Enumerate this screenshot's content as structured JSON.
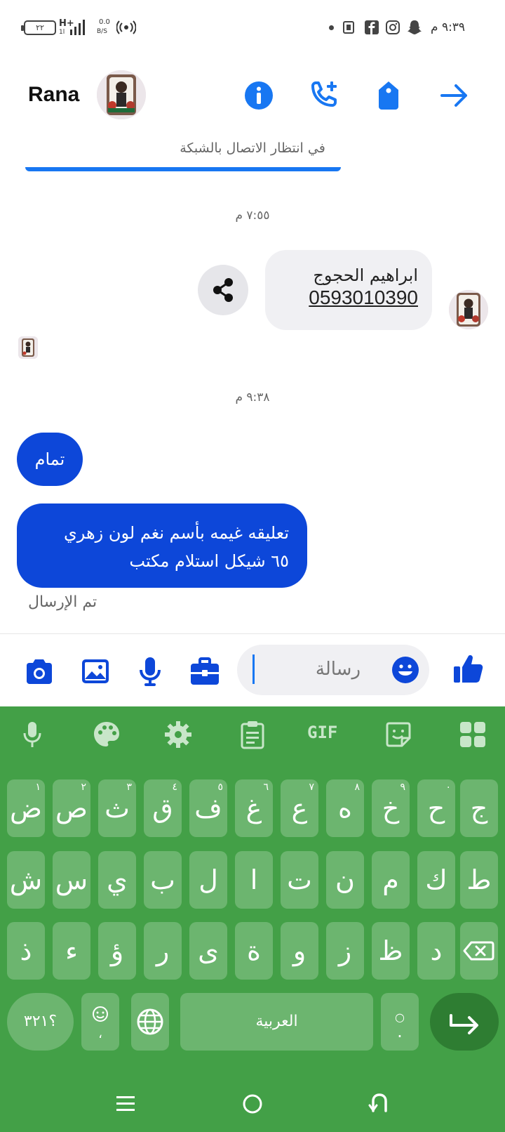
{
  "status_bar": {
    "time": "٩:٣٩ م",
    "battery": "٢٢",
    "network": "H+",
    "network_sub": "1l",
    "speed_top": "0.0",
    "speed_unit": "B/S"
  },
  "header": {
    "contact_name": "Rana",
    "icons": [
      "info-icon",
      "add-call-icon",
      "tag-icon",
      "forward-icon"
    ]
  },
  "connection_banner": "في انتظار الاتصال بالشبكة",
  "conversation": {
    "timestamp_1": "٧:٥٥ م",
    "contact_card": {
      "name": "ابراهيم الحجوج",
      "number": "0593010390"
    },
    "timestamp_2": "٩:٣٨ م",
    "messages": [
      {
        "text": "تمام"
      },
      {
        "line1": "تعليقه غيمه بأسم نغم لون زهري",
        "line2": "٦٥ شيكل استلام مكتب"
      }
    ],
    "sent_status": "تم الإرسال"
  },
  "composer": {
    "placeholder": "رسالة"
  },
  "keyboard": {
    "toolbar": [
      "mic-icon",
      "palette-icon",
      "settings-icon",
      "clipboard-icon",
      "gif-icon",
      "sticker-icon",
      "apps-icon"
    ],
    "gif_label": "GIF",
    "row1": [
      {
        "key": "ض",
        "hint": "١"
      },
      {
        "key": "ص",
        "hint": "٢"
      },
      {
        "key": "ث",
        "hint": "٣"
      },
      {
        "key": "ق",
        "hint": "٤"
      },
      {
        "key": "ف",
        "hint": "٥"
      },
      {
        "key": "غ",
        "hint": "٦"
      },
      {
        "key": "ع",
        "hint": "٧"
      },
      {
        "key": "ه",
        "hint": "٨"
      },
      {
        "key": "خ",
        "hint": "٩"
      },
      {
        "key": "ح",
        "hint": "٠"
      },
      {
        "key": "ج",
        "hint": ""
      }
    ],
    "row2": [
      "ش",
      "س",
      "ي",
      "ب",
      "ل",
      "ا",
      "ت",
      "ن",
      "م",
      "ك",
      "ط"
    ],
    "row3": [
      "ذ",
      "ء",
      "ؤ",
      "ر",
      "ى",
      "ة",
      "و",
      "ز",
      "ظ",
      "د"
    ],
    "numbers_key": "؟٣٢١",
    "comma_key": "،",
    "space_label": "العربية",
    "period_key": "."
  }
}
